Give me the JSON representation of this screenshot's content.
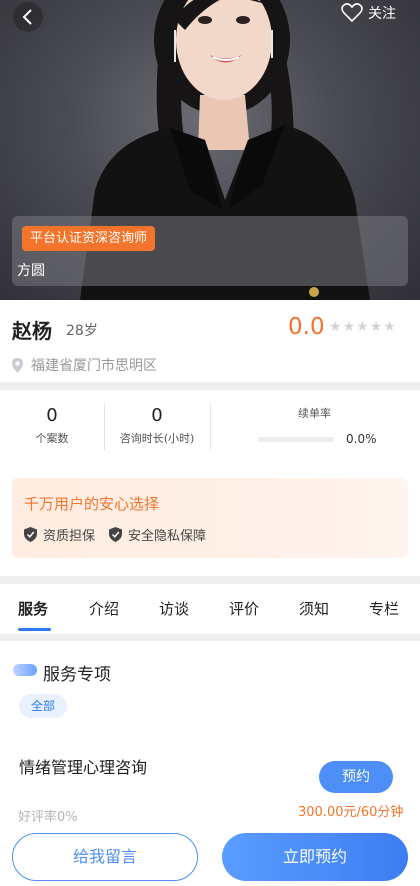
{
  "header": {
    "follow_label": "关注",
    "back_icon": "back-arrow-icon",
    "follow_icon": "heart-outline-icon"
  },
  "certification": {
    "tag": "平台认证资深咨询师",
    "name": "方圆"
  },
  "profile": {
    "name": "赵杨",
    "age": "28岁",
    "score": "0.0",
    "stars_filled": 0,
    "stars_total": 5,
    "location": "福建省厦门市思明区"
  },
  "stats": {
    "cases_value": "0",
    "cases_label": "个案数",
    "hours_value": "0",
    "hours_label": "咨询时长(小时)",
    "renew_label": "续单率",
    "renew_value": "0.0%",
    "renew_fraction": 0
  },
  "assurance": {
    "title": "千万用户的安心选择",
    "items": [
      "资质担保",
      "安全隐私保障"
    ]
  },
  "tabs": [
    "服务",
    "介绍",
    "访谈",
    "评价",
    "须知",
    "专栏"
  ],
  "active_tab": "服务",
  "services": {
    "section_title": "服务专项",
    "filter_chip": "全部",
    "item": {
      "name": "情绪管理心理咨询",
      "good_rate": "好评率0%",
      "book_label": "预约",
      "price": "300.00元/60分钟"
    }
  },
  "bottom": {
    "message_label": "给我留言",
    "book_now_label": "立即预约"
  },
  "colors": {
    "accent_orange": "#f4742b",
    "accent_blue": "#4e8ff7"
  }
}
